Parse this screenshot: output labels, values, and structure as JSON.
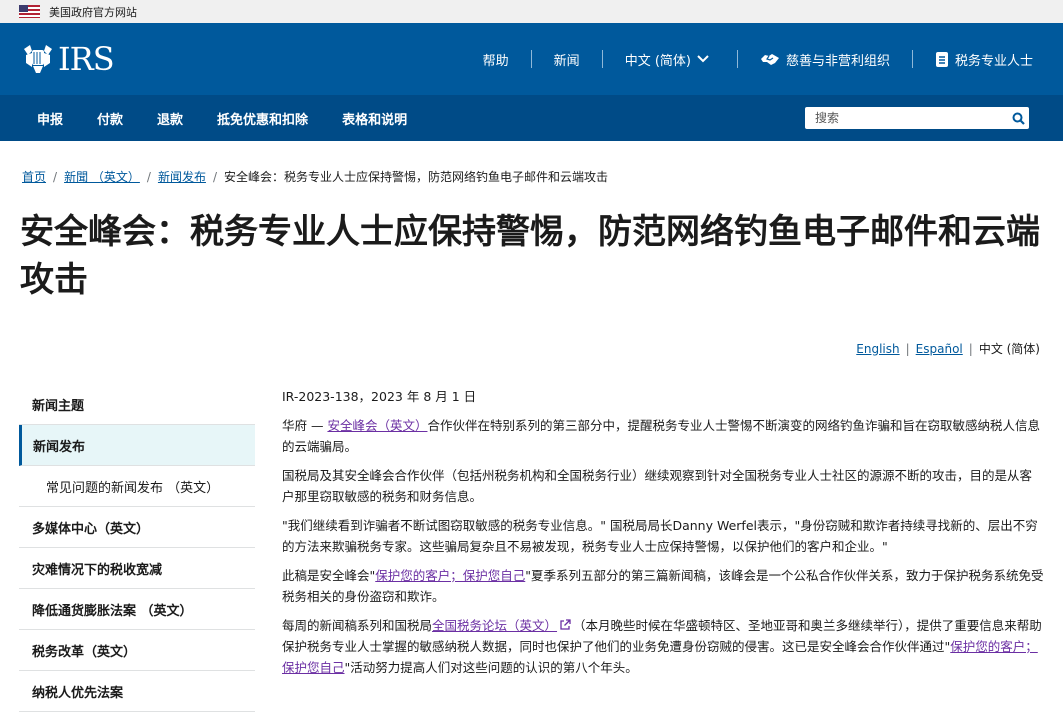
{
  "gov_banner": {
    "text": "美国政府官方网站"
  },
  "header": {
    "logo_text": "IRS",
    "util_links": [
      {
        "label": "帮助"
      },
      {
        "label": "新闻"
      },
      {
        "label": "中文 (简体)"
      },
      {
        "label": "慈善与非营利组织"
      },
      {
        "label": "税务专业人士"
      }
    ]
  },
  "main_nav": {
    "items": [
      "申报",
      "付款",
      "退款",
      "抵免优惠和扣除",
      "表格和说明"
    ],
    "search_placeholder": "搜索"
  },
  "breadcrumb": {
    "items": [
      "首页",
      "新聞 （英文）",
      "新闻发布"
    ],
    "current": "安全峰会：税务专业人士应保持警惕，防范网络钓鱼电子邮件和云端攻击"
  },
  "page_title": "安全峰会：税务专业人士应保持警惕，防范网络钓鱼电子邮件和云端攻击",
  "language_switch": {
    "english": "English",
    "spanish": "Español",
    "current": "中文 (简体)"
  },
  "sidebar": {
    "items": [
      {
        "label": "新闻主题"
      },
      {
        "label": "新闻发布"
      },
      {
        "label": "常见问题的新闻发布 （英文）"
      },
      {
        "label": "多媒体中心（英文）"
      },
      {
        "label": "灾难情况下的税收宽减"
      },
      {
        "label": "降低通货膨胀法案 （英文）"
      },
      {
        "label": "税务改革（英文）"
      },
      {
        "label": "纳税人优先法案"
      }
    ]
  },
  "article": {
    "dateline": "IR-2023-138，2023 年 8 月 1 日",
    "p1_prefix": "华府 — ",
    "p1_link": "安全峰会（英文）",
    "p1_text": "合作伙伴在特别系列的第三部分中，提醒税务专业人士警惕不断演变的网络钓鱼诈骗和旨在窃取敏感纳税人信息的云端骗局。",
    "p2": "国税局及其安全峰会合作伙伴（包括州税务机构和全国税务行业）继续观察到针对全国税务专业人士社区的源源不断的攻击，目的是从客户那里窃取敏感的税务和财务信息。",
    "p3": "\"我们继续看到诈骗者不断试图窃取敏感的税务专业信息。\" 国税局局长Danny Werfel表示，\"身份窃贼和欺诈者持续寻找新的、层出不穷的方法来欺骗税务专家。这些骗局复杂且不易被发现，税务专业人士应保持警惕，以保护他们的客户和企业。\"",
    "p4_prefix": "此稿是安全峰会\"",
    "p4_link": "保护您的客户；保护您自己",
    "p4_text": "\"夏季系列五部分的第三篇新闻稿，该峰会是一个公私合作伙伴关系，致力于保护税务系统免受税务相关的身份盗窃和欺诈。",
    "p5_prefix": "每周的新闻稿系列和国税局",
    "p5_link": "全国税务论坛（英文）",
    "p5_mid": "（本月晚些时候在华盛顿特区、圣地亚哥和奥兰多继续举行），提供了重要信息来帮助保护税务专业人士掌握的敏感纳税人数据，同时也保护了他们的业务免遭身份窃贼的侵害。这已是安全峰会合作伙伴通过\"",
    "p5_link2": "保护您的客户；保护您自己",
    "p5_end": "\"活动努力提高人们对这些问题的认识的第八个年头。"
  },
  "colors": {
    "header_blue": "#00599c",
    "nav_blue": "#004b87",
    "link_visited": "#6b2fa3"
  }
}
